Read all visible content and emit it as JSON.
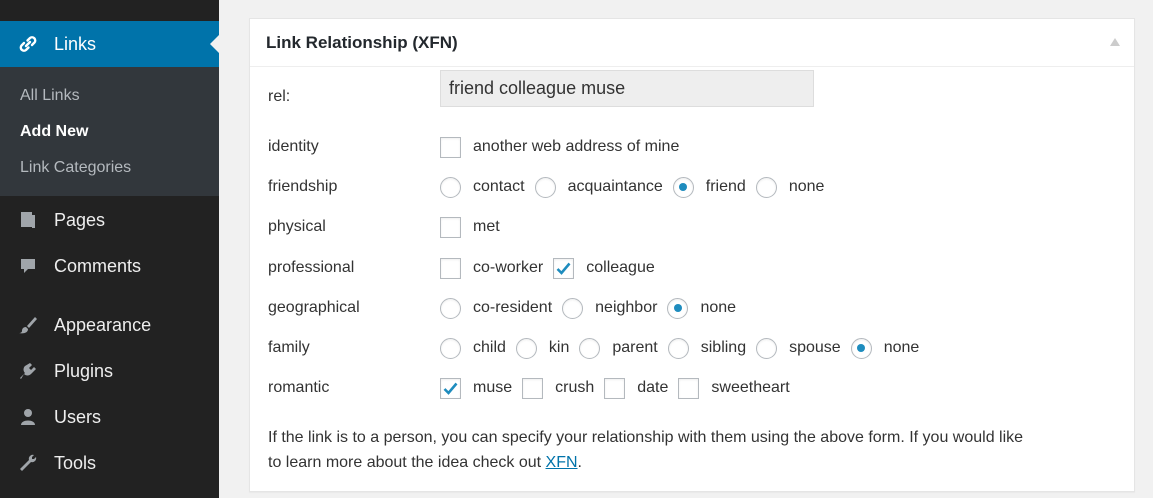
{
  "sidebar": {
    "current": {
      "label": "Links"
    },
    "submenu": [
      {
        "label": "All Links"
      },
      {
        "label": "Add New"
      },
      {
        "label": "Link Categories"
      }
    ],
    "items": [
      {
        "label": "Pages",
        "icon": "pages-icon"
      },
      {
        "label": "Comments",
        "icon": "comments-icon"
      },
      {
        "label": "Appearance",
        "icon": "appearance-icon"
      },
      {
        "label": "Plugins",
        "icon": "plugins-icon"
      },
      {
        "label": "Users",
        "icon": "users-icon"
      },
      {
        "label": "Tools",
        "icon": "tools-icon"
      }
    ]
  },
  "box": {
    "title": "Link Relationship (XFN)",
    "rel_label": "rel:",
    "rel_value": "friend colleague muse",
    "rows": {
      "identity": {
        "label": "identity",
        "options": [
          "another web address of mine"
        ]
      },
      "friendship": {
        "label": "friendship",
        "options": [
          "contact",
          "acquaintance",
          "friend",
          "none"
        ],
        "selected": "friend"
      },
      "physical": {
        "label": "physical",
        "options": [
          "met"
        ]
      },
      "professional": {
        "label": "professional",
        "options": [
          "co-worker",
          "colleague"
        ],
        "checked": [
          "colleague"
        ]
      },
      "geographical": {
        "label": "geographical",
        "options": [
          "co-resident",
          "neighbor",
          "none"
        ],
        "selected": "none"
      },
      "family": {
        "label": "family",
        "options": [
          "child",
          "kin",
          "parent",
          "sibling",
          "spouse",
          "none"
        ],
        "selected": "none"
      },
      "romantic": {
        "label": "romantic",
        "options": [
          "muse",
          "crush",
          "date",
          "sweetheart"
        ],
        "checked": [
          "muse"
        ]
      }
    },
    "help_line1": "If the link is to a person, you can specify your relationship with them using the above form. If you would like",
    "help_line2_prefix": "to learn more about the idea check out ",
    "help_link": "XFN",
    "help_line2_suffix": "."
  },
  "colors": {
    "accent": "#0073aa",
    "sidebar_bg": "#222222",
    "submenu_bg": "#32373c",
    "radio_dot": "#1e8cbe"
  }
}
